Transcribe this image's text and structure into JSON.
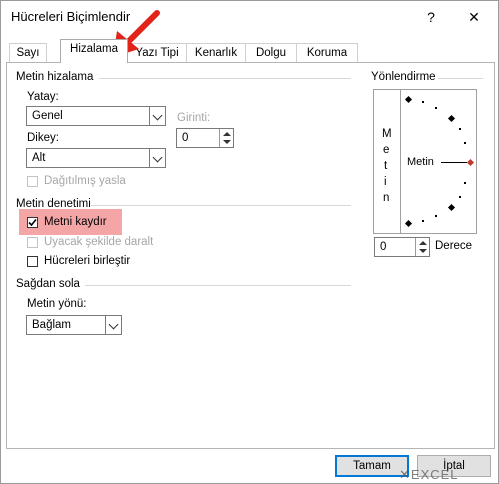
{
  "window": {
    "title": "Hücreleri Biçimlendir",
    "help_label": "?",
    "close_label": "✕"
  },
  "tabs": [
    {
      "label": "Sayı"
    },
    {
      "label": "Hizalama"
    },
    {
      "label": "Yazı Tipi"
    },
    {
      "label": "Kenarlık"
    },
    {
      "label": "Dolgu"
    },
    {
      "label": "Koruma"
    }
  ],
  "active_tab": "Hizalama",
  "text_alignment": {
    "group_label": "Metin hizalama",
    "horizontal_label": "Yatay:",
    "horizontal_value": "Genel",
    "indent_label": "Girinti:",
    "indent_value": "0",
    "vertical_label": "Dikey:",
    "vertical_value": "Alt",
    "distributed_label": "Dağıtılmış yasla"
  },
  "text_control": {
    "group_label": "Metin denetimi",
    "wrap_text_label": "Metni kaydır",
    "wrap_text_checked": true,
    "shrink_label": "Uyacak şekilde daralt",
    "merge_label": "Hücreleri birleştir"
  },
  "rtl": {
    "group_label": "Sağdan sola",
    "direction_label": "Metin yönü:",
    "direction_value": "Bağlam"
  },
  "orientation": {
    "group_label": "Yönlendirme",
    "vertical_text": [
      "M",
      "e",
      "t",
      "i",
      "n"
    ],
    "dial_text": "Metin",
    "degree_value": "0",
    "degree_label": "Derece"
  },
  "buttons": {
    "ok": "Tamam",
    "cancel": "İptal"
  },
  "watermark": "EXCEL",
  "colors": {
    "highlight": "#f4a6a6",
    "annotation_arrow": "#e2231a",
    "default_button_border": "#0078d7",
    "dial_marker": "#c0392b"
  }
}
